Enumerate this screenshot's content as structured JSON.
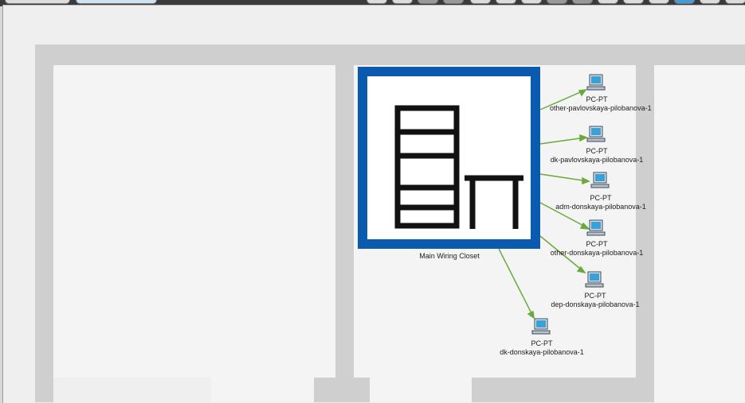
{
  "closet": {
    "label": "Main Wiring Closet"
  },
  "devices": [
    {
      "type": "PC-PT",
      "name": "other-pavlovskaya-pilobanova-1"
    },
    {
      "type": "PC-PT",
      "name": "dk-pavlovskaya-pilobanova-1"
    },
    {
      "type": "PC-PT",
      "name": "adm-donskaya-pilobanova-1"
    },
    {
      "type": "PC-PT",
      "name": "other-donskaya-pilobanova-1"
    },
    {
      "type": "PC-PT",
      "name": "dep-donskaya-pilobanova-1"
    },
    {
      "type": "PC-PT",
      "name": "dk-donskaya-pilobanova-1"
    }
  ],
  "colors": {
    "link": "#6aaa3a",
    "closet_border": "#0a5bb0",
    "pc_screen": "#3aa0d8"
  }
}
